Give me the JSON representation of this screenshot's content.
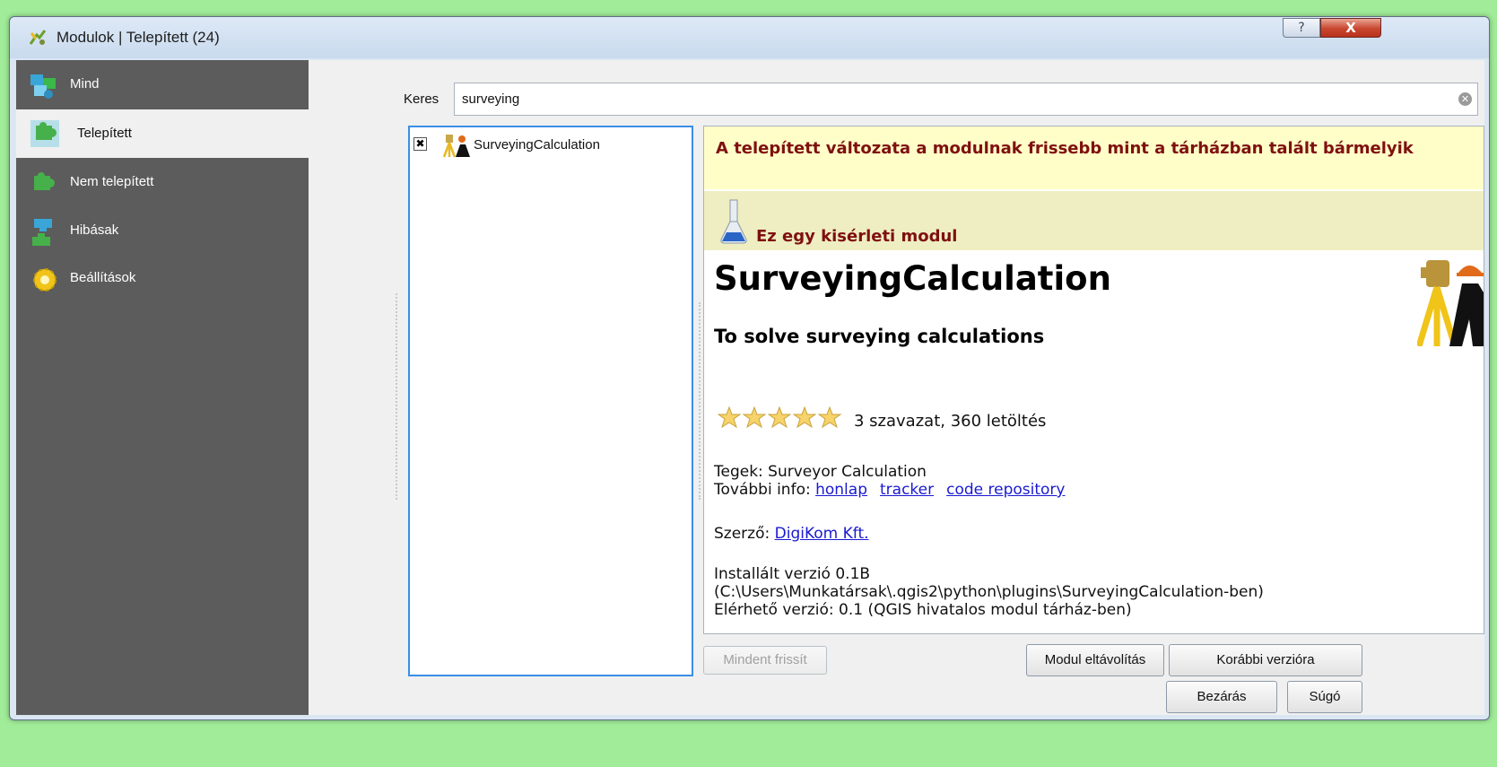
{
  "window": {
    "title": "Modulok | Telepített (24)",
    "help_label": "?",
    "close_label": "X"
  },
  "sidebar": {
    "items": [
      {
        "label": "Mind",
        "icon": "puzzle-all-icon"
      },
      {
        "label": "Telepített",
        "icon": "puzzle-installed-icon"
      },
      {
        "label": "Nem telepített",
        "icon": "puzzle-not-installed-icon"
      },
      {
        "label": "Hibásak",
        "icon": "puzzle-broken-icon"
      },
      {
        "label": "Beállítások",
        "icon": "gear-icon"
      }
    ],
    "active_index": 1
  },
  "search": {
    "label": "Keres",
    "value": "surveying"
  },
  "plugin_list": {
    "items": [
      {
        "name": "SurveyingCalculation",
        "checked": true
      }
    ]
  },
  "details": {
    "warning": "A telepített változata a modulnak frissebb mint a tárházban talált bármelyik",
    "experimental": "Ez egy kisérleti modul",
    "title": "SurveyingCalculation",
    "description": "To solve surveying calculations",
    "rating_stars": 5,
    "votes": "3 szavazat, 360 letöltés",
    "tags": "Tegek: Surveyor Calculation",
    "more_info_label": "További info:",
    "links": [
      "honlap",
      "tracker",
      "code repository"
    ],
    "author_label": "Szerző:",
    "author": "DigiKom Kft.",
    "installed_line1": "Installált verzió 0.1B",
    "installed_line2": "(C:\\Users\\Munkatársak\\.qgis2\\python\\plugins\\SurveyingCalculation-ben)",
    "available": "Elérhető verzió: 0.1 (QGIS hivatalos modul tárház-ben)"
  },
  "buttons": {
    "update_all": "Mindent frissít",
    "uninstall": "Modul eltávolítás",
    "downgrade": "Korábbi verzióra",
    "close": "Bezárás",
    "help": "Súgó"
  },
  "colors": {
    "sidebar_bg": "#5c5c5c",
    "warning_bg": "#fffec8",
    "warning_text": "#7f1010",
    "list_border": "#3b8ee6",
    "link": "#1a1ad0"
  }
}
